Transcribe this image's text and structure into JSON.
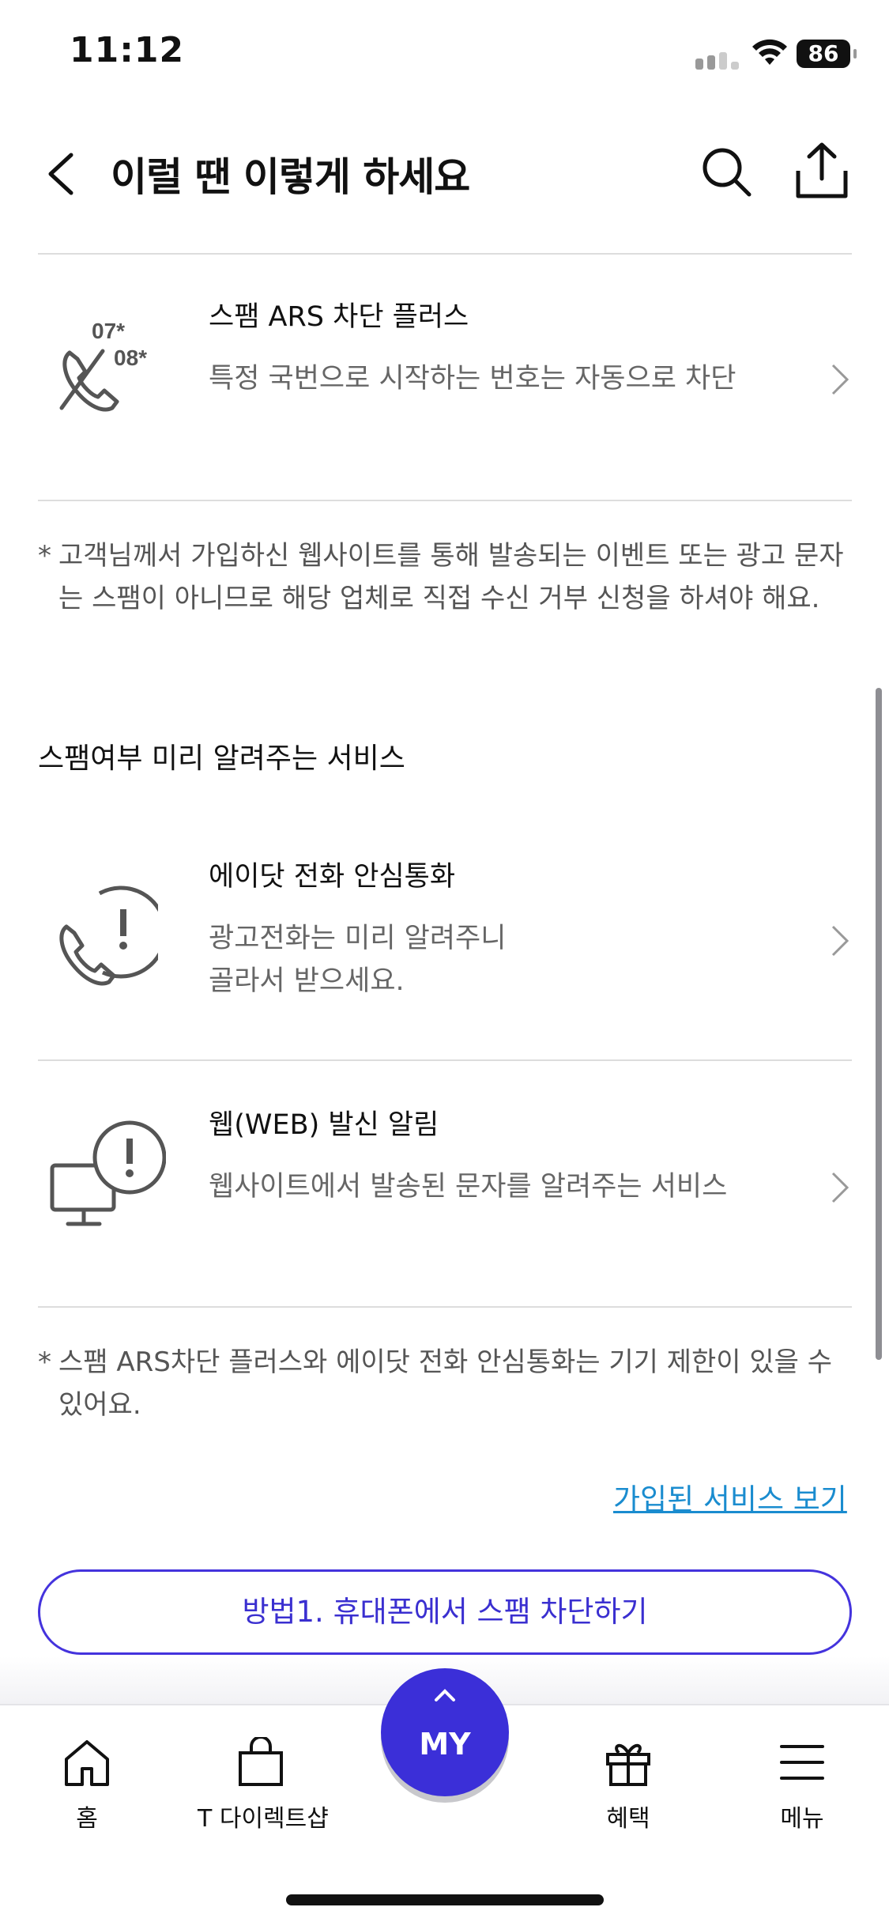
{
  "status_bar": {
    "time": "11:12",
    "battery": "86"
  },
  "header": {
    "title": "이럴 땐 이렇게 하세요"
  },
  "services_block": [
    {
      "name": "스팸 ARS 차단 플러스",
      "desc_lines": [
        "특정 국번으로 시작하는 번호는 자동으로 차단"
      ],
      "icon_text_a": "07*",
      "icon_text_b": "08*"
    }
  ],
  "note1": {
    "star": "*",
    "text": "고객님께서 가입하신 웹사이트를 통해 발송되는 이벤트 또는 광고 문자는 스팸이 아니므로 해당 업체로 직접 수신 거부 신청을 하셔야 해요."
  },
  "section_title": "스팸여부 미리 알려주는 서비스",
  "services_block2": [
    {
      "name": "에이닷 전화 안심통화",
      "desc_lines": [
        "광고전화는 미리 알려주니",
        "골라서 받으세요."
      ]
    },
    {
      "name": "웹(WEB) 발신 알림",
      "desc_lines": [
        "웹사이트에서 발송된 문자를 알려주는 서비스"
      ]
    }
  ],
  "note2": {
    "star": "*",
    "text": "스팸 ARS차단 플러스와 에이닷 전화 안심통화는 기기 제한이 있을 수 있어요."
  },
  "link": "가입된 서비스 보기",
  "cta": "방법1. 휴대폰에서 스팸 차단하기",
  "tabbar": {
    "home": "홈",
    "shop": "T 다이렉트샵",
    "my": "MY",
    "benefit": "혜택",
    "menu": "메뉴"
  },
  "colors": {
    "accent": "#3b2fd8",
    "link": "#1a8ccf"
  }
}
